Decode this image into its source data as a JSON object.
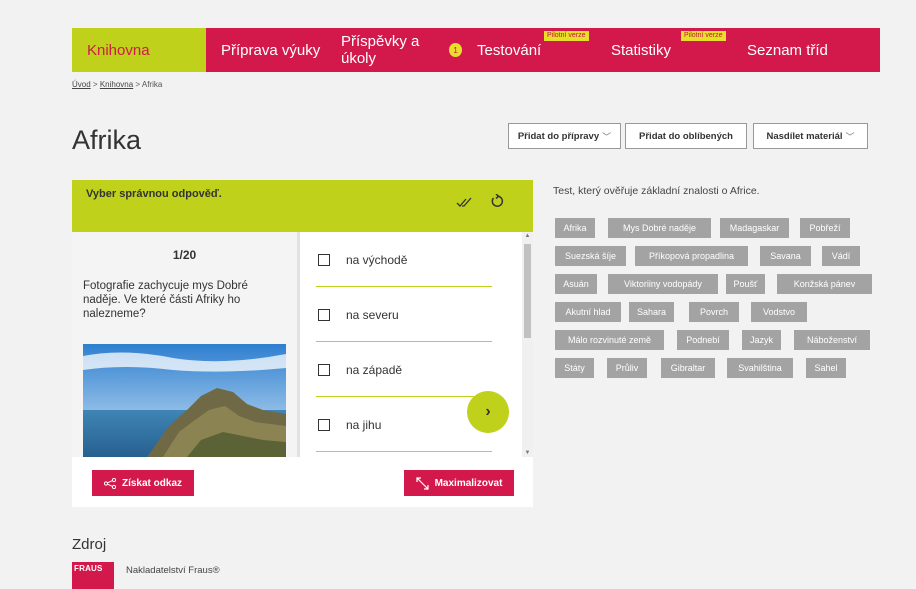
{
  "nav": {
    "items": [
      {
        "label": "Knihovna"
      },
      {
        "label": "Příprava výuky"
      },
      {
        "label": "Příspěvky a úkoly",
        "badge": "1"
      },
      {
        "label": "Testování",
        "pilot": "Pilotní verze"
      },
      {
        "label": "Statistiky",
        "pilot": "Pilotní verze"
      },
      {
        "label": "Seznam tříd"
      }
    ],
    "active_color": "#bfd11a",
    "bar_color": "#d3194b"
  },
  "breadcrumb": {
    "home": "Úvod",
    "sep1": ">",
    "library": "Knihovna",
    "sep2": ">",
    "current": "Afrika"
  },
  "page": {
    "title": "Afrika",
    "add_to_prep": "Přidat do přípravy",
    "add_to_favorites": "Přidat do oblíbených",
    "share": "Nasdílet materiál"
  },
  "quiz": {
    "header": "Vyber správnou odpověď.",
    "counter": "1/20",
    "question": "Fotografie zachycuje mys Dobré naděje. Ve které části Afriky ho nalezneme?",
    "answers": [
      "na východě",
      "na severu",
      "na západě",
      "na jihu"
    ],
    "get_link": "Získat odkaz",
    "maximize": "Maximalizovat"
  },
  "description": "Test, který ověřuje základní znalosti o Africe.",
  "tags": [
    "Afrika",
    "Mys Dobré naděje",
    "Madagaskar",
    "Pobřeží",
    "Suezská šíje",
    "Příkopová propadlina",
    "Savana",
    "Vádí",
    "Asuán",
    "Viktoriiny vodopády",
    "Poušť",
    "Konžská pánev",
    "Akutní hlad",
    "Sahara",
    "Povrch",
    "Vodstvo",
    "Málo rozvinuté země",
    "Podnebí",
    "Jazyk",
    "Náboženství",
    "Státy",
    "Průliv",
    "Gibraltar",
    "Svahilština",
    "Sahel"
  ],
  "source": {
    "title": "Zdroj",
    "logo": "FRAUS",
    "publisher": "Nakladatelství Fraus®"
  }
}
